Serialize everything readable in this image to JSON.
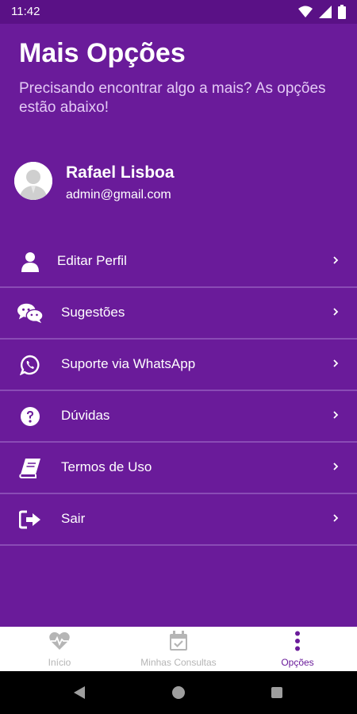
{
  "status_bar": {
    "time": "11:42",
    "icons": [
      "wifi-icon",
      "signal-icon",
      "battery-icon"
    ]
  },
  "header": {
    "title": "Mais Opções",
    "subtitle": "Precisando encontrar algo a mais? As opções estão abaixo!"
  },
  "profile": {
    "name": "Rafael Lisboa",
    "email": "admin@gmail.com"
  },
  "menu": {
    "items": [
      {
        "label": "Editar Perfil",
        "icon": "user-icon"
      },
      {
        "label": "Sugestões",
        "icon": "chat-bubbles-icon"
      },
      {
        "label": "Suporte via WhatsApp",
        "icon": "whatsapp-icon"
      },
      {
        "label": "Dúvidas",
        "icon": "question-icon"
      },
      {
        "label": "Termos de Uso",
        "icon": "book-icon"
      },
      {
        "label": "Sair",
        "icon": "logout-icon"
      }
    ]
  },
  "bottom_nav": {
    "items": [
      {
        "label": "Início",
        "icon": "heartbeat-icon",
        "active": false
      },
      {
        "label": "Minhas Consultas",
        "icon": "calendar-check-icon",
        "active": false
      },
      {
        "label": "Opções",
        "icon": "more-vertical-icon",
        "active": true
      }
    ]
  },
  "colors": {
    "primary": "#6a1b9a",
    "status_bar": "#5a1186",
    "divider": "#8a4bb5",
    "nav_inactive": "#b5b5b5"
  }
}
